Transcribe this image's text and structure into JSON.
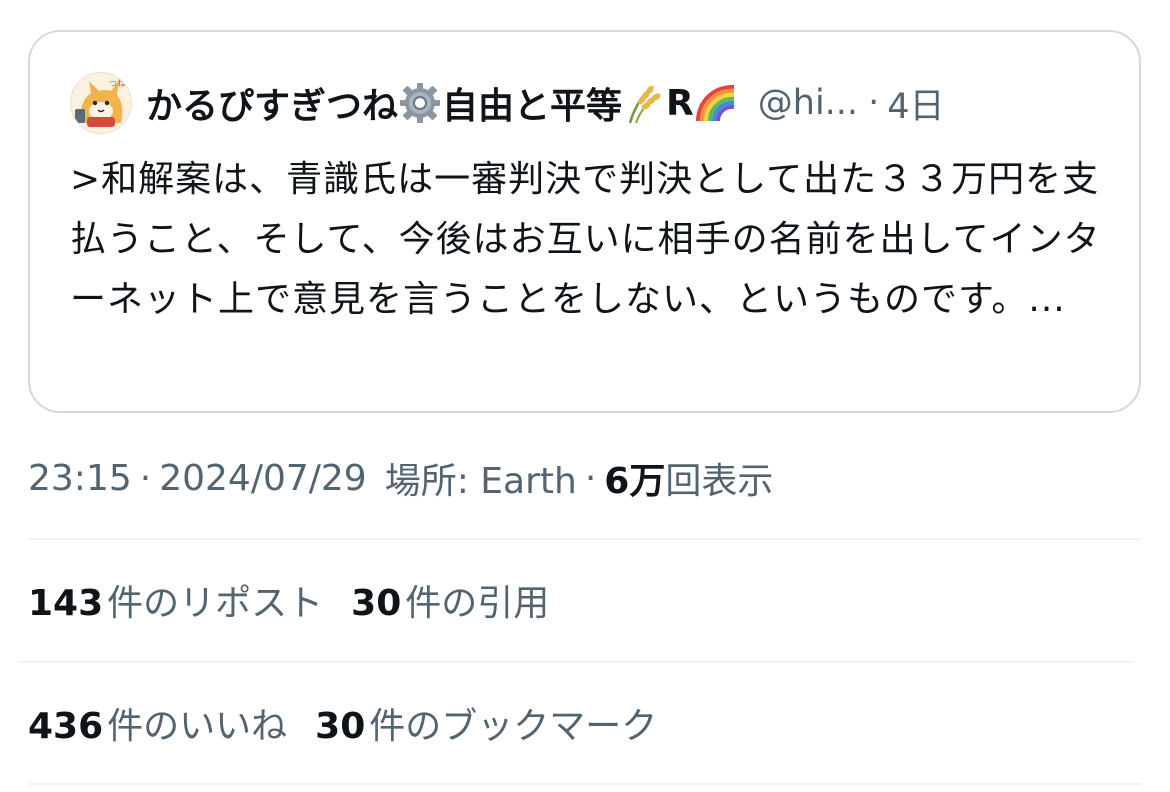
{
  "quoted_tweet": {
    "display_name_part1": "かるぴすぎつね",
    "display_name_part2": "自由と平等",
    "display_name_part3": "R",
    "name_emojis": [
      "gear-icon",
      "rice-icon",
      "rainbow-icon"
    ],
    "handle": "@hi...",
    "separator": "·",
    "time_ago": "4日",
    "text": ">和解案は、青識氏は一審判決で判決として出た３３万円を支払うこと、そして、今後はお互いに相手の名前を出してインターネット上で意見を言うことをしない、というものです。..."
  },
  "meta": {
    "time": "23:15",
    "sep1": "·",
    "date": "2024/07/29",
    "location": "場所: Earth",
    "sep2": "·",
    "views_count": "6万",
    "views_label": "回表示"
  },
  "stats": {
    "reposts_count": "143",
    "reposts_label": "件のリポスト",
    "quotes_count": "30",
    "quotes_label": "件の引用",
    "likes_count": "436",
    "likes_label": "件のいいね",
    "bookmarks_count": "30",
    "bookmarks_label": "件のブックマーク"
  },
  "colors": {
    "text_primary": "#0f1419",
    "text_secondary": "#536471",
    "border": "#cfd9de",
    "divider": "#eff3f4"
  }
}
